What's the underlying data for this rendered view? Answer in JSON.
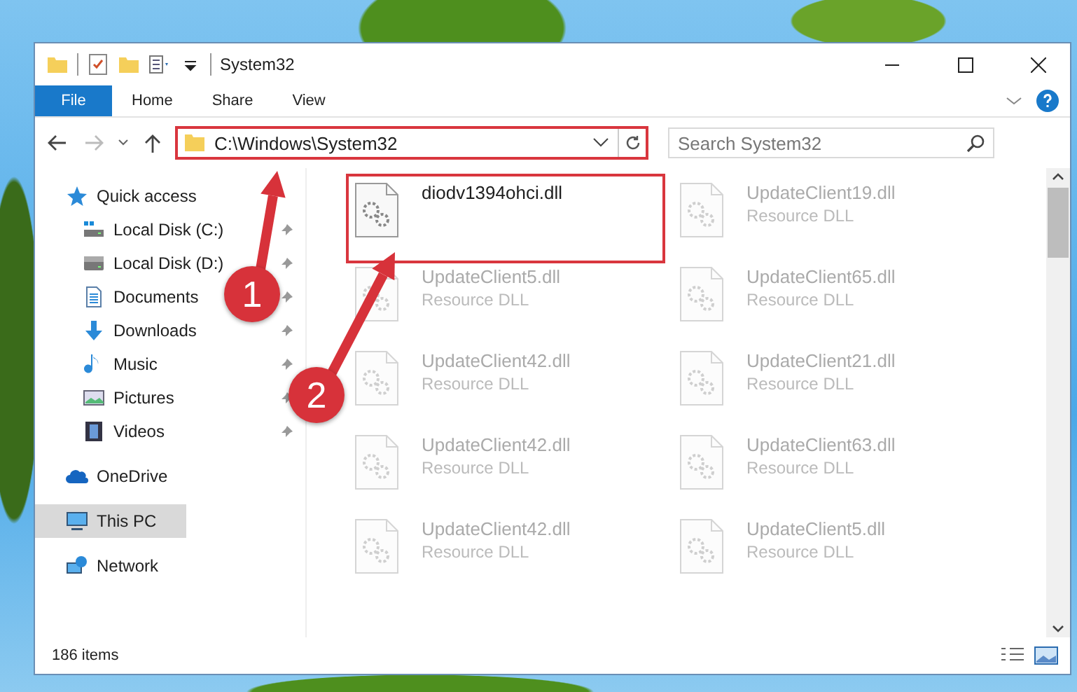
{
  "window": {
    "title": "System32"
  },
  "ribbon_tabs": [
    {
      "label": "File",
      "kind": "menu"
    },
    {
      "label": "Home",
      "kind": "tab"
    },
    {
      "label": "Share",
      "kind": "tab"
    },
    {
      "label": "View",
      "kind": "tab"
    }
  ],
  "address_bar": {
    "path": "C:\\Windows\\System32",
    "highlighted": true
  },
  "search": {
    "placeholder": "Search System32"
  },
  "navigation": {
    "forward_disabled": true
  },
  "sidebar": {
    "items": [
      {
        "label": "Quick access",
        "kind": "star",
        "selected": false,
        "children": [
          {
            "label": "Local Disk (C:)",
            "kind": "system-drive",
            "pinned": true,
            "selected": false
          },
          {
            "label": "Local Disk (D:)",
            "kind": "drive",
            "pinned": true,
            "selected": false
          },
          {
            "label": "Documents",
            "kind": "documents",
            "pinned": true,
            "selected": false
          },
          {
            "label": "Downloads",
            "kind": "downloads",
            "pinned": true,
            "selected": false
          },
          {
            "label": "Music",
            "kind": "music",
            "pinned": true,
            "selected": false
          },
          {
            "label": "Pictures",
            "kind": "pictures",
            "pinned": true,
            "selected": false
          },
          {
            "label": "Videos",
            "kind": "videos",
            "pinned": true,
            "selected": false
          }
        ]
      },
      {
        "label": "OneDrive",
        "kind": "cloud",
        "selected": false
      },
      {
        "label": "This PC",
        "kind": "computer",
        "selected": true
      },
      {
        "label": "Network",
        "kind": "network",
        "selected": false
      }
    ]
  },
  "files": [
    {
      "name": "diodv1394ohci.dll",
      "faded": false,
      "highlighted": true
    },
    {
      "name": "UpdateClient19.dll",
      "type": "Resource DLL",
      "faded": true,
      "highlighted": false
    },
    {
      "name": "UpdateClient5.dll",
      "type": "Resource DLL",
      "faded": true,
      "highlighted": false
    },
    {
      "name": "UpdateClient65.dll",
      "type": "Resource DLL",
      "faded": true,
      "highlighted": false
    },
    {
      "name": "UpdateClient42.dll",
      "type": "Resource DLL",
      "faded": true,
      "highlighted": false
    },
    {
      "name": "UpdateClient21.dll",
      "type": "Resource DLL",
      "faded": true,
      "highlighted": false
    },
    {
      "name": "UpdateClient42.dll",
      "type": "Resource DLL",
      "faded": true,
      "highlighted": false
    },
    {
      "name": "UpdateClient63.dll",
      "type": "Resource DLL",
      "faded": true,
      "highlighted": false
    },
    {
      "name": "UpdateClient42.dll",
      "type": "Resource DLL",
      "faded": true,
      "highlighted": false
    },
    {
      "name": "UpdateClient5.dll",
      "type": "Resource DLL",
      "faded": true,
      "highlighted": false
    }
  ],
  "status_bar": {
    "item_count": "186 items"
  },
  "annotations": [
    {
      "number": "1"
    },
    {
      "number": "2"
    }
  ]
}
